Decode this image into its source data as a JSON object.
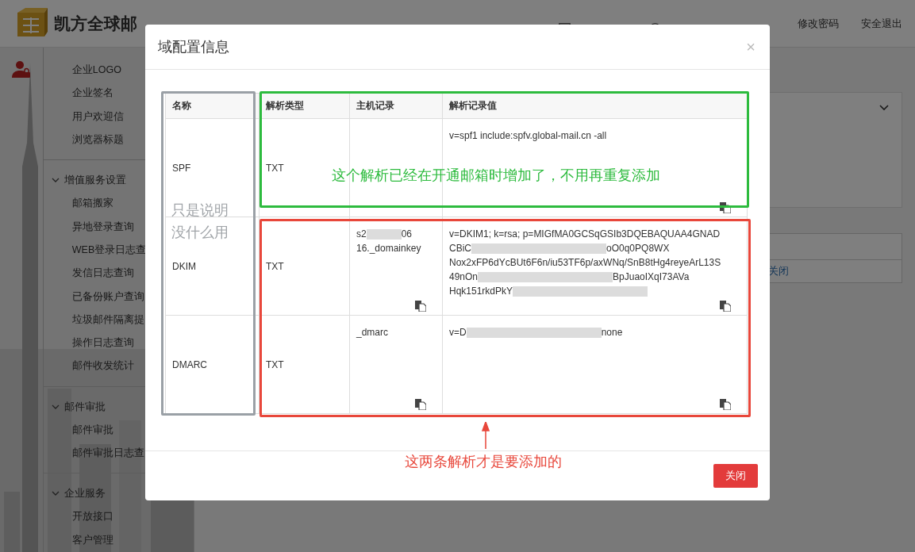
{
  "header": {
    "brand": "凯方全球邮",
    "links": [
      "修改密码",
      "安全退出"
    ]
  },
  "sidebar": {
    "groups": [
      {
        "items": [
          "企业LOGO",
          "企业签名",
          "用户欢迎信",
          "浏览器标题"
        ]
      },
      {
        "title": "增值服务设置",
        "expanded": true,
        "items": [
          "邮箱搬家",
          "异地登录查询",
          "WEB登录日志查",
          "发信日志查询",
          "已备份账户查询",
          "垃圾邮件隔离提",
          "操作日志查询",
          "邮件收发统计"
        ]
      },
      {
        "title": "邮件审批",
        "expanded": true,
        "items": [
          "邮件审批",
          "邮件审批日志查"
        ]
      },
      {
        "title": "企业服务",
        "expanded": true,
        "items": [
          "开放接口",
          "客户管理"
        ]
      }
    ]
  },
  "background": {
    "close_link": "关闭"
  },
  "dialog": {
    "title": "域配置信息",
    "close": "×",
    "table": {
      "columns": [
        "名称",
        "解析类型",
        "主机记录",
        "解析记录值"
      ],
      "rows": [
        {
          "name": "SPF",
          "type": "TXT",
          "host": {
            "copy": false
          },
          "value": {
            "lines": [
              [
                {
                  "text": "v=spf1 include:spfv.global-mail.cn -all"
                }
              ]
            ],
            "copy": true
          }
        },
        {
          "name": "DKIM",
          "type": "TXT",
          "host": {
            "lines": [
              [
                {
                  "text": "s2"
                },
                {
                  "kind": "redacted"
                },
                {
                  "text": "06"
                }
              ],
              [
                {
                  "text": "16._domainkey"
                }
              ]
            ],
            "copy": true
          },
          "value": {
            "lines": [
              [
                {
                  "text": "v=DKIM1; k=rsa; p=MIGfMA0GCSqGSIb3DQEBAQUAA4GNAD"
                }
              ],
              [
                {
                  "text": "CBiC"
                },
                {
                  "kind": "redacted"
                },
                {
                  "text": "oO0q0PQ8WX"
                }
              ],
              [
                {
                  "text": "Nox2xFP6dYcBUt6F6n/iu53TF6p/axWNq/SnB8tHg4reyeArL13S"
                }
              ],
              [
                {
                  "text": "49nOn"
                },
                {
                  "kind": "redacted"
                },
                {
                  "text": "BpJuaoIXqI73AVa"
                }
              ],
              [
                {
                  "text": "Hqk151rkdPkY"
                },
                {
                  "kind": "redacted"
                }
              ]
            ],
            "copy": true
          }
        },
        {
          "name": "DMARC",
          "type": "TXT",
          "host": {
            "lines": [
              [
                {
                  "text": "_dmarc"
                }
              ]
            ],
            "copy": true
          },
          "value": {
            "lines": [
              [
                {
                  "text": "v=D"
                },
                {
                  "kind": "redacted"
                },
                {
                  "text": "none"
                }
              ]
            ],
            "copy": true
          }
        }
      ]
    },
    "annotations": {
      "name_note": "只是说明没什么用",
      "spf_note": "这个解析已经在开通邮箱时增加了，不用再重复添加",
      "add_note": "这两条解析才是要添加的"
    },
    "footer_button": "关闭"
  }
}
